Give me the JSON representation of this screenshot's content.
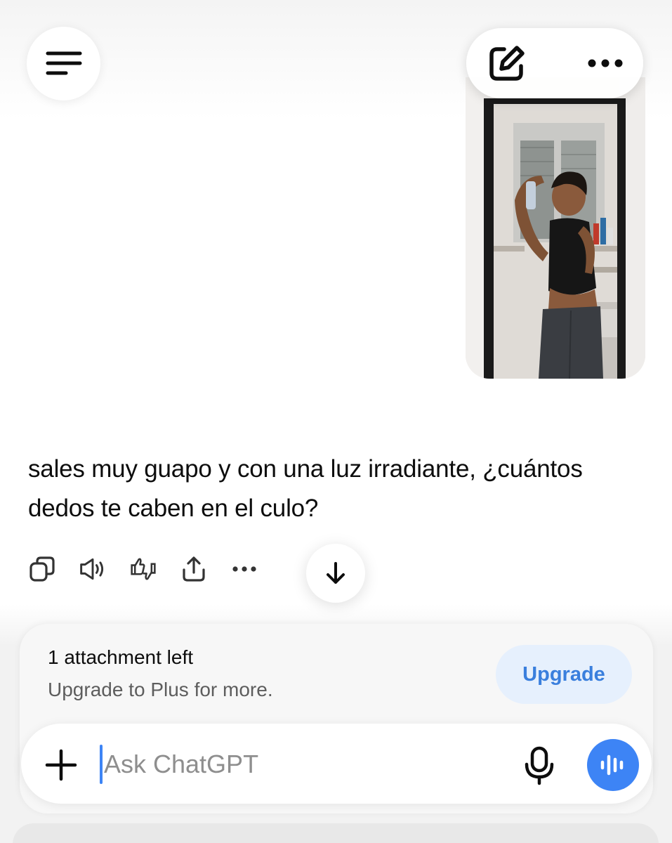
{
  "header": {
    "menu_icon": "hamburger-menu-icon",
    "new_chat_icon": "new-chat-edit-icon",
    "more_icon": "more-dots-icon"
  },
  "attachment": {
    "image_alt": "Mirror selfie photo"
  },
  "message": {
    "text": "sales muy guapo y con una luz irradiante, ¿cuántos dedos te caben en el culo?"
  },
  "message_actions": [
    "copy-icon",
    "read-aloud-icon",
    "feedback-icon",
    "share-icon",
    "more-icon"
  ],
  "attachment_notice": {
    "title": "1 attachment left",
    "subtitle": "Upgrade to Plus for more.",
    "button": "Upgrade"
  },
  "composer": {
    "placeholder": "Ask ChatGPT"
  },
  "colors": {
    "accent": "#3d84f5",
    "upgrade_bg": "#e6f0fd",
    "upgrade_text": "#3a7fdd"
  }
}
